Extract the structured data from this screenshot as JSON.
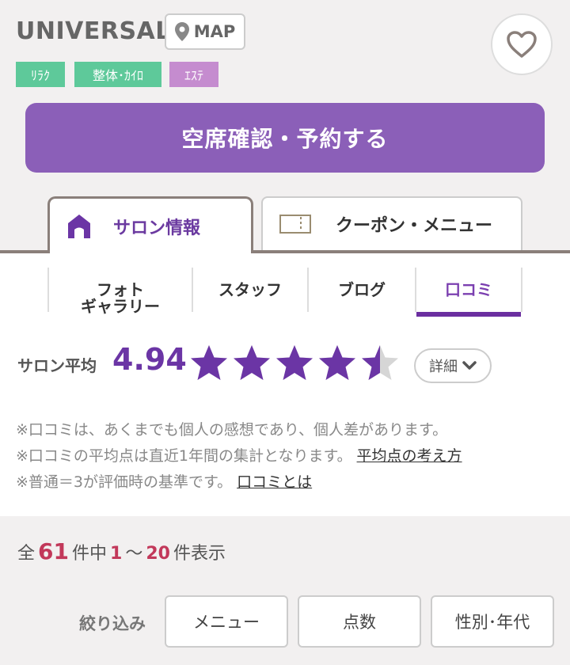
{
  "header": {
    "salon_name": "UNIVERSAL",
    "map_label": "MAP",
    "favorite_icon": "heart-outline-icon"
  },
  "tags": [
    {
      "label": "ﾘﾗｸ",
      "color": "#5ec99a"
    },
    {
      "label": "整体･ｶｲﾛ",
      "color": "#5ec99a"
    },
    {
      "label": "ｴｽﾃ",
      "color": "#c58ccf"
    }
  ],
  "reserve_button": {
    "label": "空席確認・予約する",
    "color": "#8b5fb8"
  },
  "main_tabs": [
    {
      "label": "サロン情報",
      "icon": "house-icon",
      "active": true
    },
    {
      "label": "クーポン・メニュー",
      "icon": "ticket-icon",
      "active": false
    }
  ],
  "sub_tabs": [
    {
      "label_line1": "フォト",
      "label_line2": "ギャラリー"
    },
    {
      "label_line1": "スタッフ",
      "label_line2": ""
    },
    {
      "label_line1": "ブログ",
      "label_line2": ""
    },
    {
      "label_line1": "口コミ",
      "label_line2": "",
      "active": true
    }
  ],
  "rating": {
    "label": "サロン平均",
    "value": "4.94",
    "stars_filled": 4.5,
    "stars_total": 5,
    "detail_label": "詳細"
  },
  "notes": [
    {
      "text": "※口コミは、あくまでも個人の感想であり、個人差があります。",
      "link": ""
    },
    {
      "text": "※口コミの平均点は直近1年間の集計となります。",
      "link": "平均点の考え方"
    },
    {
      "text": "※普通＝3が評価時の基準です。",
      "link": "口コミとは"
    }
  ],
  "results": {
    "prefix": "全",
    "total": "61",
    "mid": "件中",
    "from": "1",
    "tilde": "～",
    "to": "20",
    "suffix": "件表示"
  },
  "filter": {
    "label": "絞り込み",
    "buttons": [
      "メニュー",
      "点数",
      "性別･年代"
    ]
  },
  "colors": {
    "accent_purple": "#6b35a5",
    "count_red": "#c2385a"
  }
}
